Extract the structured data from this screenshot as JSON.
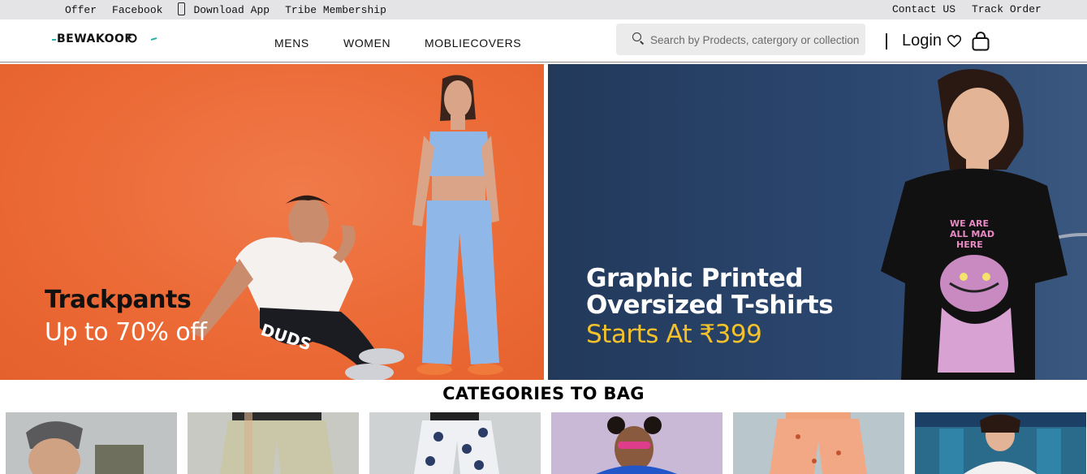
{
  "topbar": {
    "left_links": [
      "Offer",
      "Facebook",
      "Download App",
      "Tribe Membership"
    ],
    "right_links": [
      "Contact US",
      "Track Order"
    ]
  },
  "header": {
    "logo_text": "Bewakoof",
    "nav": [
      "MENS",
      "WOMEN",
      "MOBLIECOVERS"
    ],
    "search_placeholder": "Search by Prodects, catergory or collection",
    "login_label": "Login",
    "icons": [
      "search-icon",
      "heart-icon",
      "bag-icon",
      "phone-icon"
    ]
  },
  "banners": [
    {
      "title": "Trackpants",
      "subtitle": "Up to 70% off",
      "background": "#ec6a36"
    },
    {
      "title": "Graphic Printed Oversized T-shirts",
      "subtitle": "Starts At ₹399",
      "background": "#2c4770",
      "accent": "#f3c12b"
    }
  ],
  "categories": {
    "title": "CATEGORIES TO BAG",
    "cards": [
      {
        "background": "#bfc3c4"
      },
      {
        "background": "#c7c9c2"
      },
      {
        "background": "#cfd2d3"
      },
      {
        "background": "#c9b9d6"
      },
      {
        "background": "#b9c7cd"
      },
      {
        "background": "#2a6a8a"
      }
    ]
  }
}
